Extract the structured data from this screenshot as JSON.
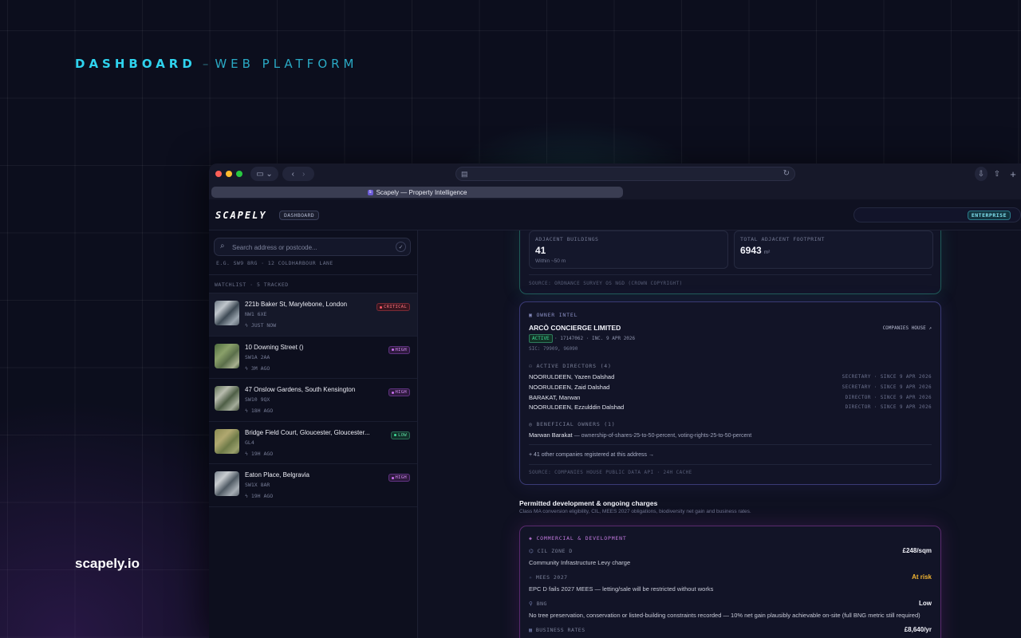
{
  "hero": {
    "title_bold": "DASHBOARD",
    "dash": "–",
    "title_light": "WEB PLATFORM",
    "site": "scapely.io"
  },
  "browser": {
    "tab_title": "Scapely — Property Intelligence",
    "address_value": ""
  },
  "app": {
    "logo": "SCAPELY",
    "section_pill": "DASHBOARD",
    "plan_badge": "ENTERPRISE"
  },
  "sidebar": {
    "search_placeholder": "Search address or postcode...",
    "search_hint": "E.G. SW9 8RG · 12 COLDHARBOUR LANE",
    "watchlist_header": "WATCHLIST · 5 TRACKED",
    "items": [
      {
        "title": "221b Baker St, Marylebone, London",
        "code": "NW1 6XE",
        "time": "JUST NOW",
        "badge": "CRITICAL",
        "severity": "critical",
        "thumb": "aerial-city"
      },
      {
        "title": "10 Downing Street ()",
        "code": "SW1A 2AA",
        "time": "3M AGO",
        "badge": "HIGH",
        "severity": "high",
        "thumb": "aerial-green"
      },
      {
        "title": "47 Onslow Gardens, South Kensington",
        "code": "SW10 9QX",
        "time": "18H AGO",
        "badge": "HIGH",
        "severity": "high",
        "thumb": "aerial-streets"
      },
      {
        "title": "Bridge Field Court, Gloucester, Gloucester...",
        "code": "GL4",
        "time": "19H AGO",
        "badge": "LOW",
        "severity": "low",
        "thumb": "aerial-field"
      },
      {
        "title": "Eaton Place, Belgravia",
        "code": "SW1X 8AR",
        "time": "19H AGO",
        "badge": "HIGH",
        "severity": "high",
        "thumb": "aerial-terrace"
      }
    ]
  },
  "adjacent": {
    "buildings_label": "ADJACENT BUILDINGS",
    "buildings_value": "41",
    "buildings_sub": "Within ~50 m",
    "footprint_label": "TOTAL ADJACENT FOOTPRINT",
    "footprint_value": "6943",
    "footprint_unit": "m²",
    "source": "SOURCE: ORDNANCE SURVEY OS NGD (CROWN COPYRIGHT)"
  },
  "owner": {
    "header": "OWNER INTEL",
    "company": "ARCÒ CONCIERGE LIMITED",
    "companies_house_link": "COMPANIES HOUSE",
    "status": "ACTIVE",
    "meta": "· 17147062 · INC. 9 APR 2026",
    "sic": "SIC: 79909, 96090",
    "directors_header": "ACTIVE DIRECTORS (4)",
    "directors": [
      {
        "name": "NOORULDEEN, Yazen Dalshad",
        "role": "SECRETARY · SINCE 9 APR 2026"
      },
      {
        "name": "NOORULDEEN, Zaid Dalshad",
        "role": "SECRETARY · SINCE 9 APR 2026"
      },
      {
        "name": "BARAKAT, Marwan",
        "role": "DIRECTOR · SINCE 9 APR 2026"
      },
      {
        "name": "NOORULDEEN, Ezzulddin Dalshad",
        "role": "DIRECTOR · SINCE 9 APR 2026"
      }
    ],
    "owners_header": "BENEFICIAL OWNERS (1)",
    "owner_name": "Marwan Barakat",
    "owner_detail": "— ownership-of-shares-25-to-50-percent, voting-rights-25-to-50-percent",
    "other_companies": "+ 41 other companies registered at this address →",
    "source": "SOURCE: COMPANIES HOUSE PUBLIC DATA API · 24H CACHE"
  },
  "permitted": {
    "title": "Permitted development & ongoing charges",
    "subtitle": "Class MA conversion eligibility, CIL, MEES 2027 obligations, biodiversity net gain and business rates."
  },
  "commercial": {
    "header": "COMMERCIAL & DEVELOPMENT",
    "rows": [
      {
        "label": "CIL ZONE D",
        "desc": "Community Infrastructure Levy charge",
        "value": "£248/sqm",
        "value_color": "#f2f3fa"
      },
      {
        "label": "MEES 2027",
        "desc": "EPC D fails 2027 MEES — letting/sale will be restricted without works",
        "value": "At risk",
        "value_color": "#f2b531"
      },
      {
        "label": "BNG",
        "desc": "No tree preservation, conservation or listed-building constraints recorded — 10% net gain plausibly achievable on-site (full BNG metric still required)",
        "value": "Low",
        "value_color": "#f2f3fa"
      },
      {
        "label": "BUSINESS RATES",
        "desc": "",
        "value": "£8,640/yr",
        "value_color": "#f2f3fa"
      }
    ]
  },
  "colors": {
    "accent_cyan": "#2fd3ee",
    "critical": "#ff5a67",
    "high": "#c86ef0",
    "low": "#3ddc97",
    "active": "#3ddc97",
    "at_risk": "#f2b531"
  },
  "icons": {
    "search": "search-icon",
    "owner": "building-icon",
    "directors": "people-icon",
    "owners": "shield-icon",
    "commercial": "layers-icon"
  }
}
